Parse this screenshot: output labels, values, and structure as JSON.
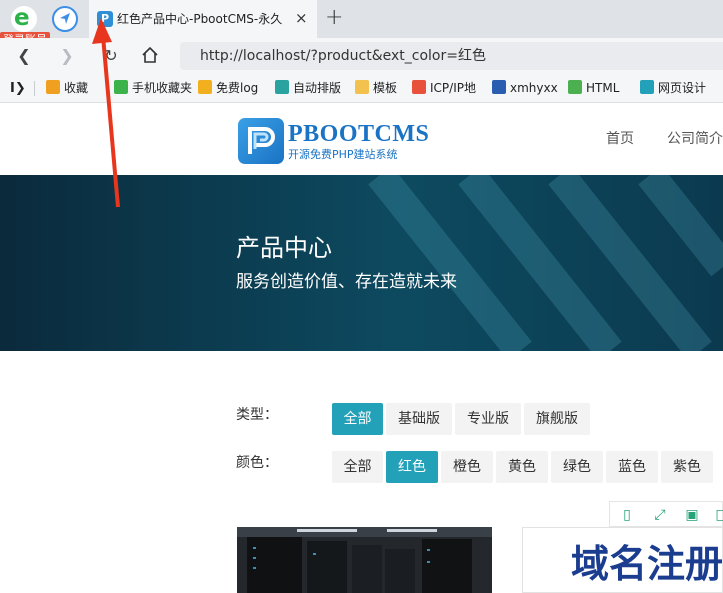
{
  "browser": {
    "login_badge": "登录账号",
    "tab": {
      "title": "红色产品中心-PbootCMS-永久",
      "close": "×"
    },
    "new_tab": "+",
    "address": "http://localhost/?product&ext_color=红色",
    "bookmarks": [
      {
        "label": "收藏",
        "icon": "star-icon",
        "color": "#f0a020"
      },
      {
        "label": "手机收藏夹",
        "icon": "phone-icon",
        "color": "#3cb34a"
      },
      {
        "label": "免费log",
        "icon": "gear-icon",
        "color": "#f2b01e"
      },
      {
        "label": "自动排版",
        "icon": "puzzle-icon",
        "color": "#2aa3a0"
      },
      {
        "label": "模板",
        "icon": "folder-icon",
        "color": "#f2c14e"
      },
      {
        "label": "ICP/IP地",
        "icon": "icp-icon",
        "color": "#e8523d"
      },
      {
        "label": "xmhyxx",
        "icon": "xm-icon",
        "color": "#2a5db0"
      },
      {
        "label": "HTML",
        "icon": "html-icon",
        "color": "#4caf50"
      },
      {
        "label": "网页设计",
        "icon": "web-icon",
        "color": "#22a1b8"
      }
    ]
  },
  "site": {
    "logo": {
      "name": "PBOOTCMS",
      "tagline": "开源免费PHP建站系统"
    },
    "nav": [
      "首页",
      "公司简介"
    ],
    "banner": {
      "title": "产品中心",
      "subtitle": "服务创造价值、存在造就未来"
    },
    "filters": {
      "type": {
        "label": "类型：",
        "options": [
          "全部",
          "基础版",
          "专业版",
          "旗舰版"
        ],
        "active_index": 0
      },
      "color": {
        "label": "颜色：",
        "options": [
          "全部",
          "红色",
          "橙色",
          "黄色",
          "绿色",
          "蓝色",
          "紫色"
        ],
        "active_index": 1
      }
    },
    "cards": {
      "right_text": "域名注册"
    }
  },
  "colors": {
    "accent": "#22a1b8",
    "banner": "#0d4a60",
    "annotation": "#e8361e"
  }
}
